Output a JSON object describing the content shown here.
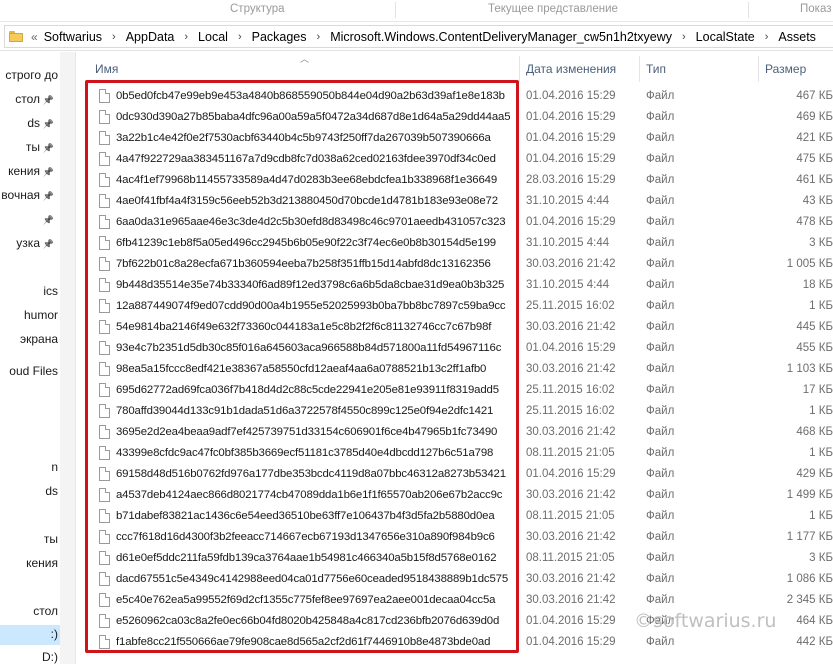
{
  "ribbon": {
    "groups": [
      "",
      "Структура",
      "Текущее представление",
      "Показ"
    ]
  },
  "address_bar": {
    "overflow_glyph": "«",
    "crumbs": [
      "Softwarius",
      "AppData",
      "Local",
      "Packages",
      "Microsoft.Windows.ContentDeliveryManager_cw5n1h2txyewy",
      "LocalState",
      "Assets"
    ],
    "separator": "›"
  },
  "nav_pane": {
    "items": [
      {
        "label": "стрoго дo",
        "pinned": false
      },
      {
        "label": "стол",
        "pinned": true
      },
      {
        "label": "ds",
        "pinned": true
      },
      {
        "label": "ты",
        "pinned": true
      },
      {
        "label": "кения",
        "pinned": true
      },
      {
        "label": "вочная",
        "pinned": true
      },
      {
        "label": "",
        "pinned": true
      },
      {
        "label": "узка",
        "pinned": true
      },
      {
        "label": "ics",
        "pinned": false
      },
      {
        "label": "humor",
        "pinned": false
      },
      {
        "label": "экрана",
        "pinned": false
      },
      {
        "label": "oud Files",
        "pinned": false
      },
      {
        "label": "n",
        "pinned": false
      },
      {
        "label": "ds",
        "pinned": false
      },
      {
        "label": "ты",
        "pinned": false
      },
      {
        "label": "кения",
        "pinned": false
      },
      {
        "label": "стол",
        "pinned": false
      },
      {
        "label": ":)",
        "pinned": false
      },
      {
        "label": "D:)",
        "pinned": false
      }
    ]
  },
  "columns": {
    "name": "Имя",
    "date": "Дата изменения",
    "type": "Тип",
    "size": "Размер"
  },
  "files": [
    {
      "name": "0b5ed0fcb47e99eb9e453a4840b868559050b844e04d90a2b63d39af1e8e183b",
      "date": "01.04.2016 15:29",
      "type": "Файл",
      "size": "467 КБ"
    },
    {
      "name": "0dc930d390a27b85baba4dfc96a00a59a5f0472a34d687d8e1d64a5a29dd44aa5",
      "date": "01.04.2016 15:29",
      "type": "Файл",
      "size": "469 КБ"
    },
    {
      "name": "3a22b1c4e42f0e2f7530acbf63440b4c5b9743f250ff7da267039b507390666a",
      "date": "01.04.2016 15:29",
      "type": "Файл",
      "size": "421 КБ"
    },
    {
      "name": "4a47f922729aa383451167a7d9cdb8fc7d038a62ced02163fdee3970df34c0ed",
      "date": "01.04.2016 15:29",
      "type": "Файл",
      "size": "475 КБ"
    },
    {
      "name": "4ac4f1ef79968b11455733589a4d47d0283b3ee68ebdcfea1b338968f1e36649",
      "date": "28.03.2016 15:29",
      "type": "Файл",
      "size": "461 КБ"
    },
    {
      "name": "4ae0f41fbf4a4f3159c56eeb52b3d213880450d70bcde1d4781b183e93e08e72",
      "date": "31.10.2015 4:44",
      "type": "Файл",
      "size": "43 КБ"
    },
    {
      "name": "6aa0da31e965aae46e3c3de4d2c5b30efd8d83498c46c9701aeedb431057c323",
      "date": "01.04.2016 15:29",
      "type": "Файл",
      "size": "478 КБ"
    },
    {
      "name": "6fb41239c1eb8f5a05ed496cc2945b6b05e90f22c3f74ec6e0b8b30154d5e199",
      "date": "31.10.2015 4:44",
      "type": "Файл",
      "size": "3 КБ"
    },
    {
      "name": "7bf622b01c8a28ecfa671b360594eeba7b258f351ffb15d14abfd8dc13162356",
      "date": "30.03.2016 21:42",
      "type": "Файл",
      "size": "1 005 КБ"
    },
    {
      "name": "9b448d35514e35e74b33340f6ad89f12ed3798c6a6b5da8cbae31d9ea0b3b325",
      "date": "31.10.2015 4:44",
      "type": "Файл",
      "size": "18 КБ"
    },
    {
      "name": "12a887449074f9ed07cdd90d00a4b1955e52025993b0ba7bb8bc7897c59ba9cc",
      "date": "25.11.2015 16:02",
      "type": "Файл",
      "size": "1 КБ"
    },
    {
      "name": "54e9814ba2146f49e632f73360c044183a1e5c8b2f2f6c81132746cc7c67b98f",
      "date": "30.03.2016 21:42",
      "type": "Файл",
      "size": "445 КБ"
    },
    {
      "name": "93e4c7b2351d5db30c85f016a645603aca966588b84d571800a11fd54967116c",
      "date": "01.04.2016 15:29",
      "type": "Файл",
      "size": "455 КБ"
    },
    {
      "name": "98ea5a15fccc8edf421e38367a58550cfd12aeaf4aa6a0788521b13c2ff1afb0",
      "date": "30.03.2016 21:42",
      "type": "Файл",
      "size": "1 103 КБ"
    },
    {
      "name": "695d62772ad69fca036f7b418d4d2c88c5cde22941e205e81e93911f8319add5",
      "date": "25.11.2015 16:02",
      "type": "Файл",
      "size": "17 КБ"
    },
    {
      "name": "780affd39044d133c91b1dada51d6a3722578f4550c899c125e0f94e2dfc1421",
      "date": "25.11.2015 16:02",
      "type": "Файл",
      "size": "1 КБ"
    },
    {
      "name": "3695e2d2ea4beaa9adf7ef425739751d33154c606901f6ce4b47965b1fc73490",
      "date": "30.03.2016 21:42",
      "type": "Файл",
      "size": "468 КБ"
    },
    {
      "name": "43399e8cfdc9ac47fc0bf385b3669ecf51181c3785d40e4dbcdd127b6c51a798",
      "date": "08.11.2015 21:05",
      "type": "Файл",
      "size": "1 КБ"
    },
    {
      "name": "69158d48d516b0762fd976a177dbe353bcdc4119d8a07bbc46312a8273b53421",
      "date": "01.04.2016 15:29",
      "type": "Файл",
      "size": "429 КБ"
    },
    {
      "name": "a4537deb4124aec866d8021774cb47089dda1b6e1f1f65570ab206e67b2acc9c",
      "date": "30.03.2016 21:42",
      "type": "Файл",
      "size": "1 499 КБ"
    },
    {
      "name": "b71dabef83821ac1436c6e54eed36510be63ff7e106437b4f3d5fa2b5880d0ea",
      "date": "08.11.2015 21:05",
      "type": "Файл",
      "size": "1 КБ"
    },
    {
      "name": "ccc7f618d16d4300f3b2feeacc714667ecb67193d1347656e310a890f984b9c6",
      "date": "30.03.2016 21:42",
      "type": "Файл",
      "size": "1 177 КБ"
    },
    {
      "name": "d61e0ef5ddc211fa59fdb139ca3764aae1b54981c466340a5b15f8d5768e0162",
      "date": "08.11.2015 21:05",
      "type": "Файл",
      "size": "3 КБ"
    },
    {
      "name": "dacd67551c5e4349c4142988eed04ca01d7756e60ceaded9518438889b1dc575",
      "date": "30.03.2016 21:42",
      "type": "Файл",
      "size": "1 086 КБ"
    },
    {
      "name": "e5c40e762ea5a99552f69d2cf1355c775fef8ee97697ea2aee001decaa04cc5a",
      "date": "30.03.2016 21:42",
      "type": "Файл",
      "size": "2 345 КБ"
    },
    {
      "name": "e5260962ca03c8a2fe0ec66b04fd8020b425848a4c817cd236bfb2076d639d0d",
      "date": "01.04.2016 15:29",
      "type": "Файл",
      "size": "464 КБ"
    },
    {
      "name": "f1abfe8cc21f550666ae79fe908cae8d565a2cf2d61f7446910b8e4873bde0ad",
      "date": "01.04.2016 15:29",
      "type": "Файл",
      "size": "442 КБ"
    }
  ],
  "watermark": "©softwarius.ru",
  "colors": {
    "highlight_red": "#d0121b",
    "header_text": "#4c607a",
    "selected_nav": "#cce8ff"
  }
}
